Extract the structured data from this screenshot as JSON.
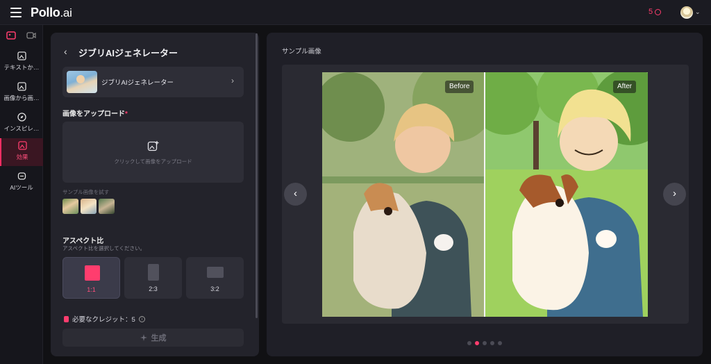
{
  "header": {
    "logo_main": "Pollo",
    "logo_suffix": ".ai",
    "credits": "5"
  },
  "sidebar": {
    "items": [
      {
        "label": "テキストか…",
        "icon": "image-gen-icon"
      },
      {
        "label": "画像から画…",
        "icon": "image-to-image-icon"
      },
      {
        "label": "インスピレ…",
        "icon": "compass-icon"
      },
      {
        "label": "効果",
        "icon": "effects-icon",
        "active": true
      },
      {
        "label": "AIツール",
        "icon": "ai-tools-icon"
      }
    ]
  },
  "panel": {
    "title": "ジブリAIジェネレーター",
    "model_name": "ジブリAIジェネレーター",
    "upload_label": "画像をアップロード",
    "upload_required": "*",
    "upload_hint": "クリックして画像をアップロード",
    "sample_label": "サンプル画像を試す",
    "aspect_title": "アスペクト比",
    "aspect_sub": "アスペクト比を選択してください。",
    "ratios": [
      "1:1",
      "2:3",
      "3:2"
    ],
    "credit_text": "必要なクレジット：5",
    "generate_label": "生成"
  },
  "main": {
    "title": "サンプル画像",
    "before_tag": "Before",
    "after_tag": "After",
    "carousel_active_index": 1,
    "carousel_count": 5
  },
  "colors": {
    "accent": "#ff3d6e",
    "background": "#111114",
    "panel": "#23232b"
  }
}
